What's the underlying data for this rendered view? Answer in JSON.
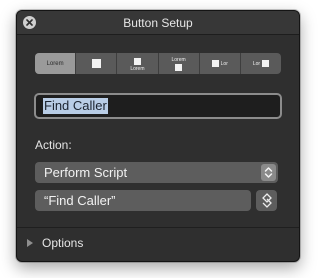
{
  "window": {
    "title": "Button Setup"
  },
  "segments": [
    {
      "label": "Lorem",
      "selected": true
    },
    {
      "label": "",
      "icon": "square-icon"
    },
    {
      "label": "Lorem",
      "icon": "square-icon"
    },
    {
      "label": "Lorem",
      "icon": "square-icon"
    },
    {
      "label": "Lor",
      "icon": "square-icon"
    },
    {
      "label": "Lor",
      "icon": "square-icon"
    }
  ],
  "button_name": {
    "value": "Find Caller"
  },
  "action": {
    "label": "Action:",
    "selected": "Perform Script",
    "script": "“Find Caller”"
  },
  "options": {
    "label": "Options"
  },
  "colors": {
    "window_bg": "#2f2f2f",
    "control_bg": "#5d5d5d",
    "selection": "#b9cde6"
  }
}
